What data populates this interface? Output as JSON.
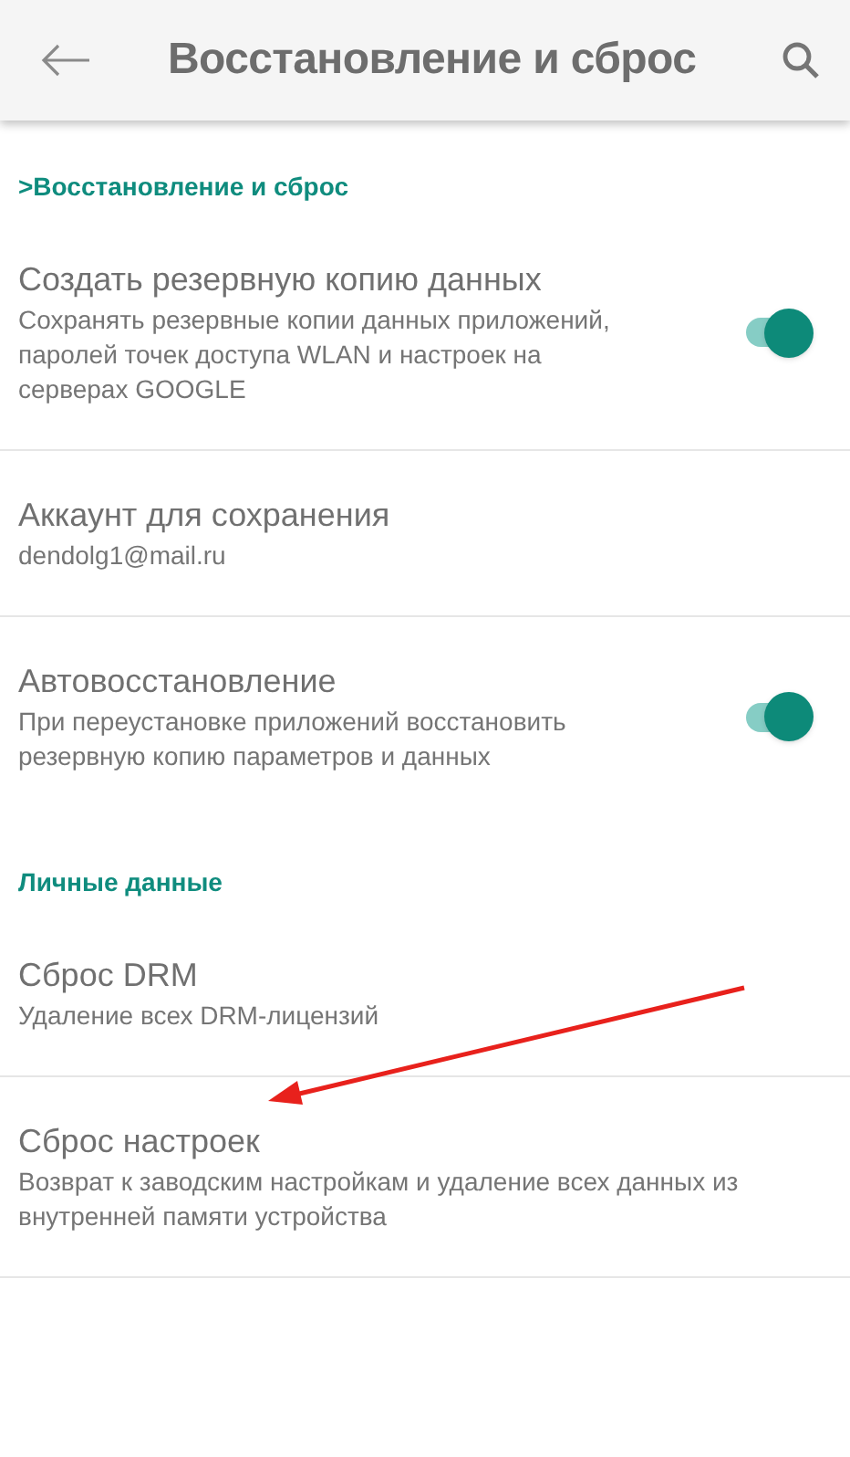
{
  "app_bar": {
    "title": "Восстановление и сброс"
  },
  "sections": [
    {
      "header": ">Восстановление и сброс",
      "items": [
        {
          "kind": "switch",
          "title": "Создать резервную копию данных",
          "summary": "Сохранять резервные копии данных приложений, паролей точек доступа WLAN и настроек на серверах GOOGLE",
          "on": true,
          "divider": true
        },
        {
          "kind": "plain",
          "title": "Аккаунт для сохранения",
          "summary": "dendolg1@mail.ru",
          "divider": true
        },
        {
          "kind": "switch",
          "title": "Автовосстановление",
          "summary": "При переустановке приложений восстановить резервную копию параметров и данных",
          "on": true,
          "divider": false
        }
      ]
    },
    {
      "header": "Личные данные",
      "items": [
        {
          "kind": "plain",
          "title": "Сброс DRM",
          "summary": "Удаление всех DRM-лицензий",
          "divider": true
        },
        {
          "kind": "plain",
          "title": "Сброс настроек",
          "summary": "Возврат к заводским настройкам и удаление всех данных из внутренней памяти устройства",
          "divider": true
        }
      ]
    }
  ]
}
